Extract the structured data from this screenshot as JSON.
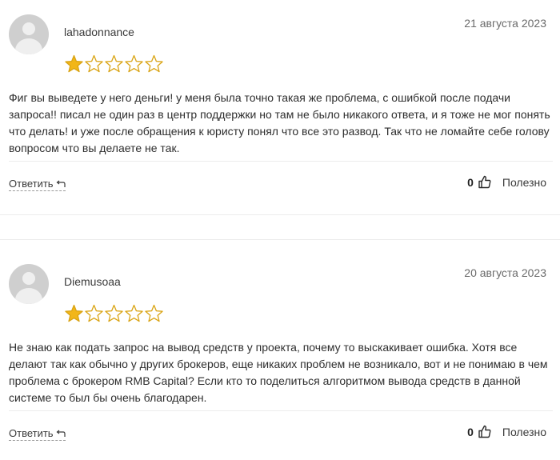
{
  "reviews": [
    {
      "username": "lahadonnance",
      "date": "21 августа 2023",
      "rating": 1,
      "max_rating": 5,
      "text": "Фиг вы выведете у него деньги! у меня была точно такая же проблема, с ошибкой после подачи запроса!! писал не один раз в центр поддержки но там не было никакого ответа, и я тоже не мог понять что делать! и уже после обращения к юристу понял что все это развод. Так что не ломайте себе голову вопросом что вы делаете не так.",
      "reply_label": "Ответить",
      "useful_count": "0",
      "useful_label": "Полезно"
    },
    {
      "username": "Diemusoaa",
      "date": "20 августа 2023",
      "rating": 1,
      "max_rating": 5,
      "text": "Не знаю как подать запрос на вывод средств у проекта, почему то выскакивает ошибка. Хотя все делают так как обычно у других брокеров, еще никаких проблем не возникало, вот и не понимаю в чем проблема с брокером RMB Capital? Если кто то поделиться алгоритмом вывода средств в данной системе то был бы очень благодарен.",
      "reply_label": "Ответить",
      "useful_count": "0",
      "useful_label": "Полезно"
    }
  ],
  "colors": {
    "star_fill": "#f2b619",
    "star_stroke": "#d9a313",
    "text": "#2e2e2e",
    "date": "#6b6b6b"
  },
  "icons": {
    "avatar": "user-avatar-placeholder",
    "star": "star-icon",
    "reply": "reply-arrow-icon",
    "thumb": "thumbs-up-icon"
  }
}
